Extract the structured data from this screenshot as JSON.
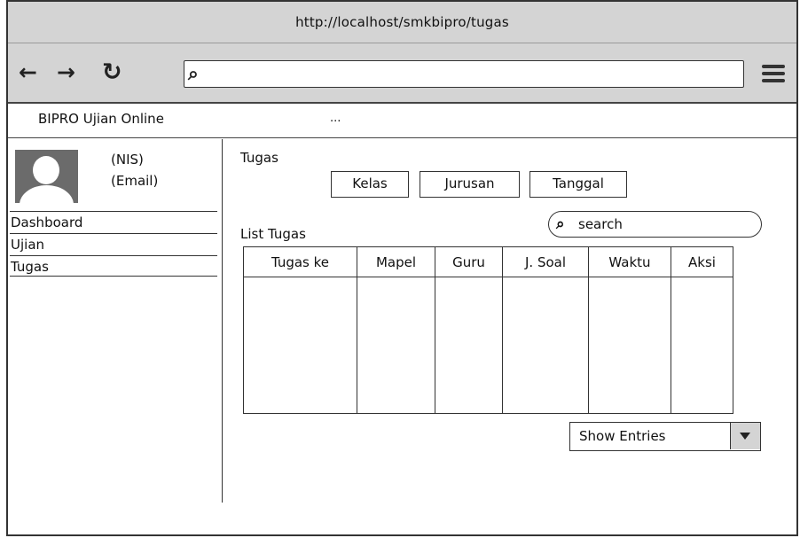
{
  "browser": {
    "url": "http://localhost/smkbipro/tugas",
    "back_glyph": "←",
    "forward_glyph": "→",
    "reload_glyph": "↻",
    "search_glyph": "⌕",
    "address_value": ""
  },
  "app": {
    "title": "BIPRO Ujian Online",
    "ellipsis": "..."
  },
  "profile": {
    "nis": "(NIS)",
    "email": "(Email)"
  },
  "sidebar": {
    "items": [
      {
        "label": "Dashboard"
      },
      {
        "label": "Ujian"
      },
      {
        "label": "Tugas"
      }
    ]
  },
  "main": {
    "title": "Tugas",
    "filters": [
      "Kelas",
      "Jurusan",
      "Tanggal"
    ],
    "list_title": "List Tugas",
    "search": {
      "placeholder": "search",
      "icon_glyph": "⌕"
    },
    "table": {
      "columns": [
        "Tugas ke",
        "Mapel",
        "Guru",
        "J. Soal",
        "Waktu",
        "Aksi"
      ],
      "rows": []
    },
    "show_entries_label": "Show Entries"
  }
}
